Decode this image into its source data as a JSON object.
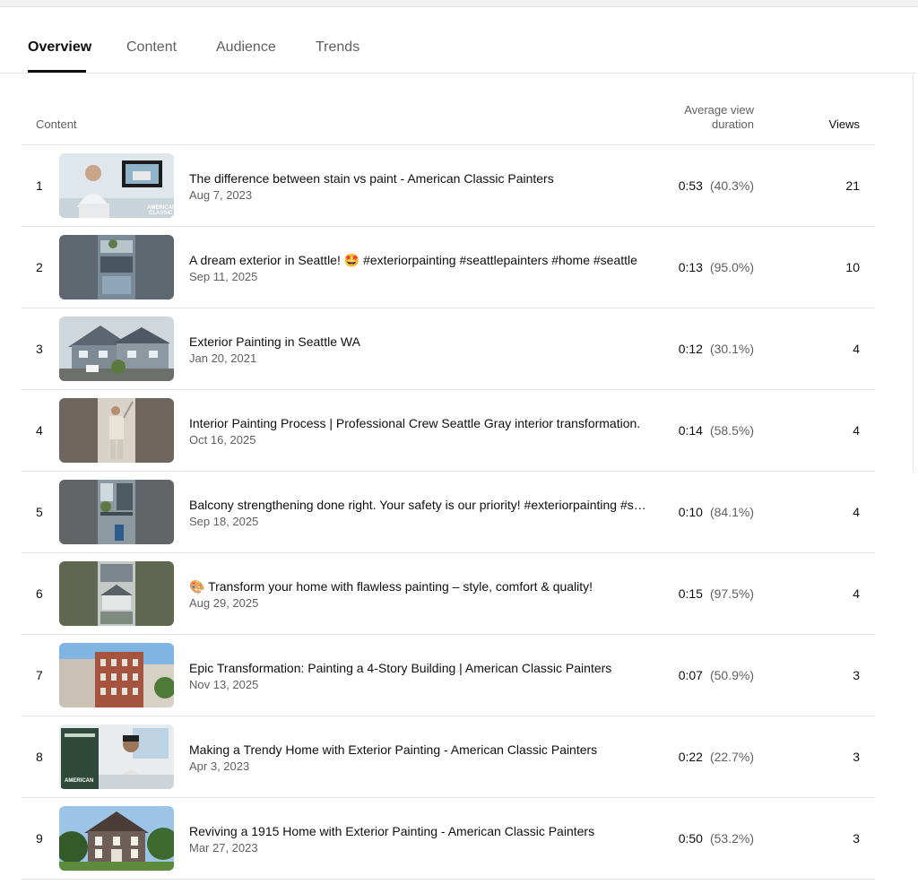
{
  "tabs": [
    {
      "label": "Overview",
      "active": true
    },
    {
      "label": "Content",
      "active": false
    },
    {
      "label": "Audience",
      "active": false
    },
    {
      "label": "Trends",
      "active": false
    }
  ],
  "table": {
    "headers": {
      "content": "Content",
      "avd": "Average view duration",
      "views": "Views"
    },
    "rows": [
      {
        "rank": "1",
        "title": "The difference between stain vs paint - American Classic Painters",
        "date": "Aug 7, 2023",
        "duration": "0:53",
        "percent": "(40.3%)",
        "views": "21",
        "thumb": "person-studio"
      },
      {
        "rank": "2",
        "title": "A dream exterior in Seattle! 🤩 #exteriorpainting #seattlepainters #home #seattle",
        "date": "Sep 11, 2025",
        "duration": "0:13",
        "percent": "(95.0%)",
        "views": "10",
        "thumb": "vertical-house"
      },
      {
        "rank": "3",
        "title": "Exterior Painting in Seattle WA",
        "date": "Jan 20, 2021",
        "duration": "0:12",
        "percent": "(30.1%)",
        "views": "4",
        "thumb": "house"
      },
      {
        "rank": "4",
        "title": "Interior Painting Process | Professional Crew Seattle Gray interior transformation.",
        "date": "Oct 16, 2025",
        "duration": "0:14",
        "percent": "(58.5%)",
        "views": "4",
        "thumb": "vertical-painter"
      },
      {
        "rank": "5",
        "title": "Balcony strengthening done right. Your safety is our priority! #exteriorpainting #s…",
        "date": "Sep 18, 2025",
        "duration": "0:10",
        "percent": "(84.1%)",
        "views": "4",
        "thumb": "vertical-balcony"
      },
      {
        "rank": "6",
        "title": "🎨 Transform your home with flawless painting – style, comfort & quality!",
        "date": "Aug 29, 2025",
        "duration": "0:15",
        "percent": "(97.5%)",
        "views": "4",
        "thumb": "vertical-green"
      },
      {
        "rank": "7",
        "title": "Epic Transformation: Painting a 4-Story Building | American Classic Painters",
        "date": "Nov 13, 2025",
        "duration": "0:07",
        "percent": "(50.9%)",
        "views": "3",
        "thumb": "building"
      },
      {
        "rank": "8",
        "title": "Making a Trendy Home with Exterior Painting - American Classic Painters",
        "date": "Apr 3, 2023",
        "duration": "0:22",
        "percent": "(22.7%)",
        "views": "3",
        "thumb": "person-book"
      },
      {
        "rank": "9",
        "title": "Reviving a 1915 Home with Exterior Painting - American Classic Painters",
        "date": "Mar 27, 2023",
        "duration": "0:50",
        "percent": "(53.2%)",
        "views": "3",
        "thumb": "old-house"
      }
    ]
  }
}
